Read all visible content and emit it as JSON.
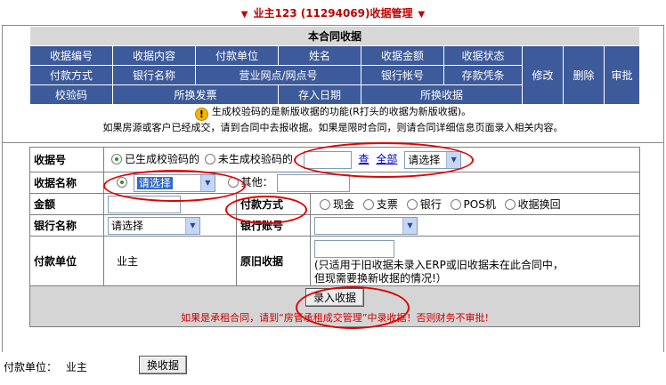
{
  "title": "业主123 (11294069)收据管理",
  "header": {
    "caption": "本合同收据",
    "row1": [
      "收据编号",
      "收据内容",
      "付款单位",
      "姓名",
      "收据金额",
      "收据状态"
    ],
    "row2": [
      "付款方式",
      "银行名称",
      "营业网点/网点号",
      "银行帐号",
      "存款凭条"
    ],
    "row3": [
      "校验码",
      "所换发票",
      "存入日期",
      "所换收据"
    ],
    "actions": [
      "修改",
      "删除",
      "审批"
    ]
  },
  "notice": {
    "line1": "生成校验码的是新版收据的功能(R打头的收据为新版收据)。",
    "line2": "如果房源或客户已经成交，请到合同中去报收据。如果是限时合同，则请合同详细信息页面录入相关内容。"
  },
  "form": {
    "receipt_no": {
      "label": "收据号",
      "opt_generated": "已生成校验码的",
      "opt_not_generated": "未生成校验码的",
      "search_link": "查",
      "all_link": "全部",
      "select_value": "请选择"
    },
    "receipt_name": {
      "label": "收据名称",
      "select_value": "请选择",
      "other_label": "其他："
    },
    "amount": {
      "label": "金额"
    },
    "pay_method": {
      "label": "付款方式",
      "options": [
        "现金",
        "支票",
        "银行",
        "POS机",
        "收据换回"
      ]
    },
    "bank_name": {
      "label": "银行名称",
      "select_value": "请选择"
    },
    "bank_account": {
      "label": "银行账号"
    },
    "payer": {
      "label": "付款单位",
      "value": "业主"
    },
    "old_receipt": {
      "label": "原旧收据",
      "note1": "(只适用于旧收据未录入ERP或旧收据未在此合同中，",
      "note2": "但现需要换新收据的情况!）"
    },
    "submit_label": "录入收据",
    "warning": "如果是承租合同，请到“房管承租成交管理”中录收据！否则财务不审批!"
  },
  "footer": {
    "payer_label": "付款单位：",
    "payer_value": "业主",
    "exchange_button": "换收据"
  },
  "colors": {
    "header_blue": "#3d5a9a",
    "title_red": "#c00000",
    "annotation_red": "#e00000"
  }
}
